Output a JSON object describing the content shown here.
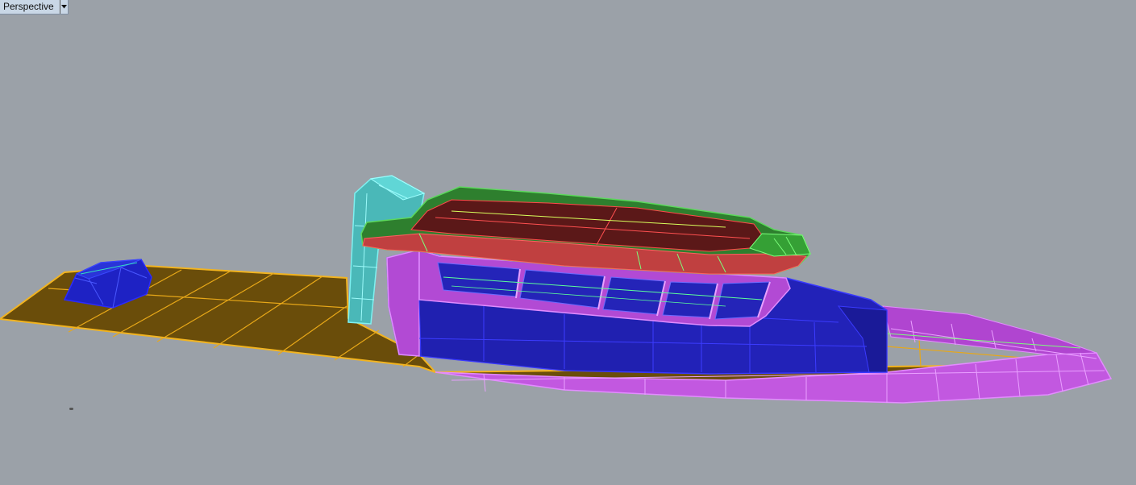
{
  "viewport": {
    "title": "Perspective",
    "dropdown_icon": "chevron-down-icon",
    "background_color": "#9ba1a8"
  },
  "model": {
    "deck_color": "#6a4d0a",
    "deck_edge_color": "#f2b420",
    "hull_color": "#c258e0",
    "cabin_color": "#1f1fb0",
    "roof_green": "#2a7a2a",
    "roof_red": "#5a1818",
    "mast_color": "#58c8c8"
  }
}
